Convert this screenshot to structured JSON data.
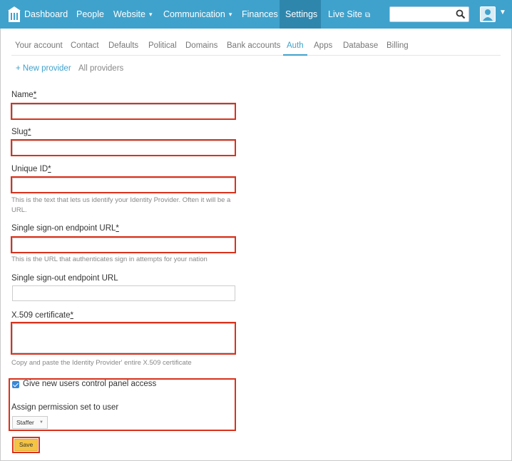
{
  "nav": {
    "items": [
      {
        "label": "Dashboard"
      },
      {
        "label": "People"
      },
      {
        "label": "Website",
        "caret": "▾"
      },
      {
        "label": "Communication",
        "caret": "▾"
      },
      {
        "label": "Finances"
      },
      {
        "label": "Settings",
        "active": true
      },
      {
        "label": "Live Site"
      }
    ],
    "search_placeholder": ""
  },
  "tabs": [
    "Your account",
    "Contact",
    "Defaults",
    "Political",
    "Domains",
    "Bank accounts",
    "Auth",
    "Apps",
    "Database",
    "Billing"
  ],
  "active_tab": "Auth",
  "sublinks": {
    "new_provider": "+ New provider",
    "all_providers": "All providers"
  },
  "form": {
    "name": {
      "label": "Name",
      "req": "*",
      "value": ""
    },
    "slug": {
      "label": "Slug",
      "req": "*",
      "value": ""
    },
    "unique_id": {
      "label": "Unique ID",
      "req": "*",
      "value": "",
      "hint": "This is the text that lets us identify your Identity Provider. Often it will be a URL."
    },
    "sso_url": {
      "label": "Single sign-on endpoint URL",
      "req": "*",
      "value": "",
      "hint": "This is the URL that authenticates sign in attempts for your nation"
    },
    "slo_url": {
      "label": "Single sign-out endpoint URL",
      "value": ""
    },
    "certificate": {
      "label": "X.509 certificate",
      "req": "*",
      "value": "",
      "hint": "Copy and paste the Identity Provider' entire X.509 certificate"
    },
    "control_panel": {
      "label": "Give new users control panel access",
      "checked": true
    },
    "permission": {
      "label": "Assign permission set to user",
      "selected": "Staffer"
    },
    "save_label": "Save"
  },
  "colors": {
    "brand": "#3fa2cc",
    "highlight": "#d9321d",
    "save": "#f6c443"
  }
}
